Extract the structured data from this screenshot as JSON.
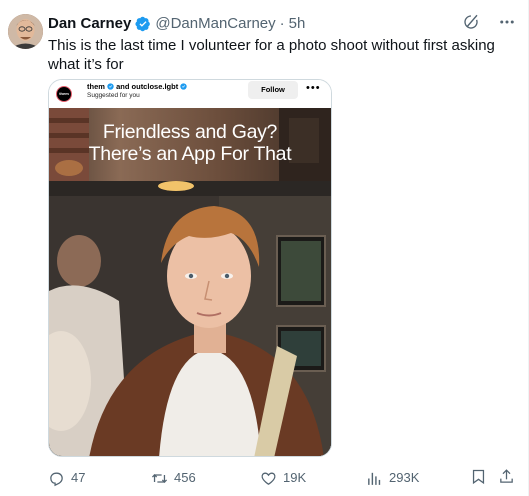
{
  "tweet": {
    "author_name": "Dan Carney",
    "author_handle": "@DanManCarney",
    "separator": "·",
    "time_ago": "5h",
    "text": "This is the last time I volunteer for a photo shoot without first asking what it’s for"
  },
  "embedded_post": {
    "logo_text": "them",
    "accounts_line": "them",
    "accounts_and": "and outclose.lgbt",
    "suggested": "Suggested for you",
    "follow_label": "Follow",
    "more": "•••",
    "headline_line1": "Friendless and Gay?",
    "headline_line2": "There’s an App For That"
  },
  "metrics": {
    "replies": "47",
    "retweets": "456",
    "likes": "19K",
    "views": "293K"
  },
  "colors": {
    "text_primary": "#0f1419",
    "text_secondary": "#536471",
    "verified_blue": "#1d9bf0",
    "border": "#cfd9de"
  },
  "icons": {
    "verified": "verified-badge-icon",
    "grok": "grok-icon",
    "more": "more-icon",
    "reply": "reply-icon",
    "retweet": "retweet-icon",
    "like": "heart-icon",
    "views": "views-icon",
    "bookmark": "bookmark-icon",
    "share": "share-icon"
  }
}
